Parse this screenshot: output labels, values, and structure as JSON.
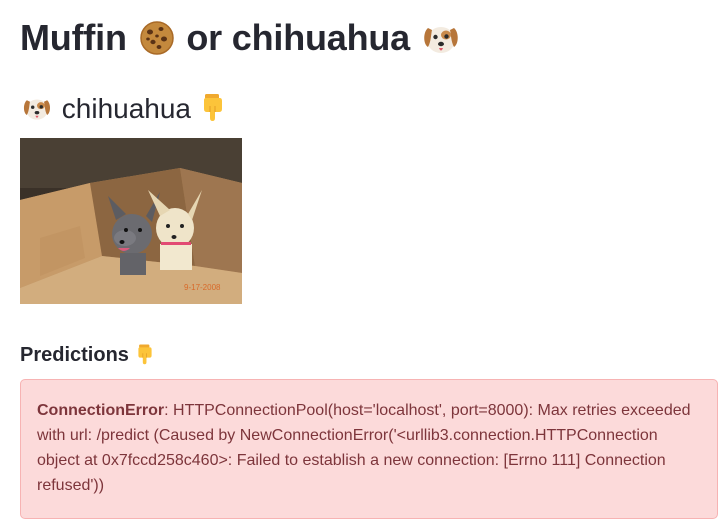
{
  "header": {
    "title_part1": "Muffin",
    "title_part2": "or chihuahua",
    "title_icons": [
      "cookie-icon",
      "dog-face-icon"
    ]
  },
  "subheader": {
    "label": "chihuahua",
    "icons": [
      "dog-face-icon",
      "pointing-down-icon"
    ]
  },
  "image": {
    "alt": "Two chihuahuas sitting in a cardboard box",
    "watermark": "9-17-2008"
  },
  "predictions": {
    "title": "Predictions",
    "icon": "pointing-down-icon"
  },
  "error": {
    "type": "ConnectionError",
    "message": ": HTTPConnectionPool(host='localhost', port=8000): Max retries exceeded with url: /predict (Caused by NewConnectionError('<urllib3.connection.HTTPConnection object at 0x7fccd258c460>: Failed to establish a new connection: [Errno 111] Connection refused'))"
  },
  "colors": {
    "text": "#262730",
    "error_bg": "#fcdada",
    "error_text": "#7d353b"
  }
}
